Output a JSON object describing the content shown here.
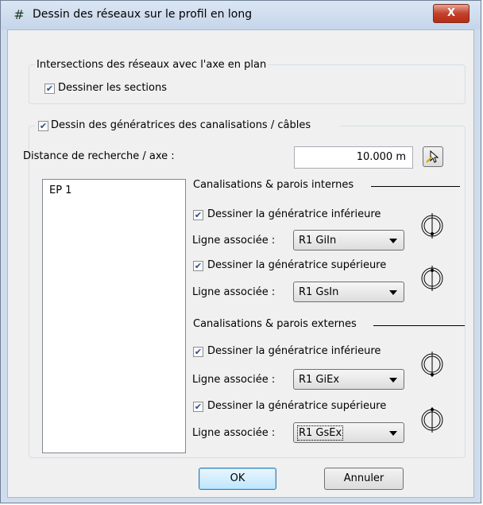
{
  "window": {
    "title": "Dessin des réseaux sur le profil en long",
    "close_label": "X",
    "app_icon": "network-grid-icon"
  },
  "intersections": {
    "group_title": "Intersections des réseaux avec l'axe en plan",
    "draw_sections_label": "Dessiner les sections",
    "draw_sections_checked": true
  },
  "generatrices": {
    "group_label": "Dessin des génératrices des canalisations / câbles",
    "group_checked": true,
    "distance_label": "Distance de recherche / axe :",
    "distance_value": "10.000 m",
    "pick_button_icon": "pick-cursor-icon",
    "list_items": [
      "EP 1"
    ],
    "internal": {
      "title": "Canalisations & parois internes",
      "lower": {
        "label": "Dessiner la génératrice inférieure",
        "checked": true,
        "assoc_label": "Ligne associée :",
        "value": "R1 GiIn",
        "icon": "pipe-lower-generatrix-icon"
      },
      "upper": {
        "label": "Dessiner la génératrice supérieure",
        "checked": true,
        "assoc_label": "Ligne associée :",
        "value": "R1 GsIn",
        "icon": "pipe-upper-generatrix-icon"
      }
    },
    "external": {
      "title": "Canalisations & parois externes",
      "lower": {
        "label": "Dessiner la génératrice inférieure",
        "checked": true,
        "assoc_label": "Ligne associée :",
        "value": "R1 GiEx",
        "icon": "pipe-lower-generatrix-icon"
      },
      "upper": {
        "label": "Dessiner la génératrice supérieure",
        "checked": true,
        "assoc_label": "Ligne associée :",
        "value": "R1 GsEx",
        "icon": "pipe-upper-generatrix-icon"
      }
    }
  },
  "buttons": {
    "ok": "OK",
    "cancel": "Annuler"
  },
  "colors": {
    "title_bg": "#cfdcec",
    "close": "#c3412b",
    "default_button": "#3c7fb1"
  }
}
